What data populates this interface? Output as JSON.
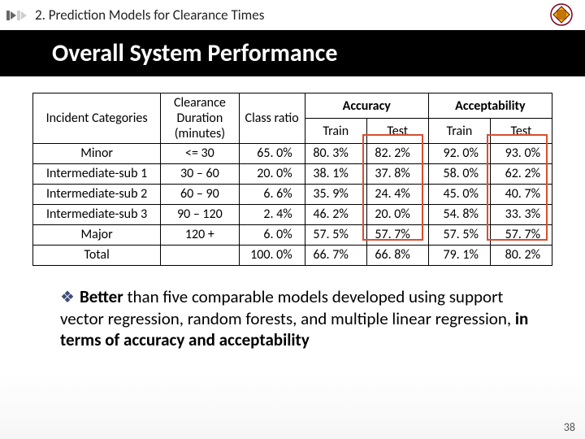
{
  "breadcrumb": "2. Prediction Models for Clearance Times",
  "title": "Overall System Performance",
  "table": {
    "headers": {
      "cat": "Incident Categories",
      "dur": "Clearance Duration (minutes)",
      "ratio": "Class ratio",
      "accuracy": "Accuracy",
      "accept": "Acceptability",
      "train": "Train",
      "test": "Test"
    },
    "rows": [
      {
        "cat": "Minor",
        "dur": "<= 30",
        "ratio": "65. 0%",
        "acc_tr": "80. 3%",
        "acc_te": "82. 2%",
        "ap_tr": "92. 0%",
        "ap_te": "93. 0%"
      },
      {
        "cat": "Intermediate-sub 1",
        "dur": "30 – 60",
        "ratio": "20. 0%",
        "acc_tr": "38. 1%",
        "acc_te": "37. 8%",
        "ap_tr": "58. 0%",
        "ap_te": "62. 2%"
      },
      {
        "cat": "Intermediate-sub 2",
        "dur": "60 – 90",
        "ratio": "6. 6%",
        "acc_tr": "35. 9%",
        "acc_te": "24. 4%",
        "ap_tr": "45. 0%",
        "ap_te": "40. 7%"
      },
      {
        "cat": "Intermediate-sub 3",
        "dur": "90 – 120",
        "ratio": "2. 4%",
        "acc_tr": "46. 2%",
        "acc_te": "20. 0%",
        "ap_tr": "54. 8%",
        "ap_te": "33. 3%"
      },
      {
        "cat": "Major",
        "dur": "120 +",
        "ratio": "6. 0%",
        "acc_tr": "57. 5%",
        "acc_te": "57. 7%",
        "ap_tr": "57. 5%",
        "ap_te": "57. 7%"
      },
      {
        "cat": "Total",
        "dur": "",
        "ratio": "100. 0%",
        "acc_tr": "66. 7%",
        "acc_te": "66. 8%",
        "ap_tr": "79. 1%",
        "ap_te": "80. 2%"
      }
    ]
  },
  "bullet": {
    "better": "Better",
    "mid": " than five comparable models developed using support vector regression, random forests, and multiple linear regression, ",
    "terms": "in terms of accuracy and acceptability"
  },
  "pagenum": "38",
  "chart_data": {
    "type": "table",
    "title": "Overall System Performance",
    "columns": [
      "Incident Categories",
      "Clearance Duration (minutes)",
      "Class ratio",
      "Accuracy Train",
      "Accuracy Test",
      "Acceptability Train",
      "Acceptability Test"
    ],
    "rows": [
      [
        "Minor",
        "<= 30",
        "65.0%",
        "80.3%",
        "82.2%",
        "92.0%",
        "93.0%"
      ],
      [
        "Intermediate-sub 1",
        "30 – 60",
        "20.0%",
        "38.1%",
        "37.8%",
        "58.0%",
        "62.2%"
      ],
      [
        "Intermediate-sub 2",
        "60 – 90",
        "6.6%",
        "35.9%",
        "24.4%",
        "45.0%",
        "40.7%"
      ],
      [
        "Intermediate-sub 3",
        "90 – 120",
        "2.4%",
        "46.2%",
        "20.0%",
        "54.8%",
        "33.3%"
      ],
      [
        "Major",
        "120 +",
        "6.0%",
        "57.5%",
        "57.7%",
        "57.5%",
        "57.7%"
      ],
      [
        "Total",
        "",
        "100.0%",
        "66.7%",
        "66.8%",
        "79.1%",
        "80.2%"
      ]
    ],
    "highlighted_columns": [
      "Accuracy Test",
      "Acceptability Test"
    ]
  }
}
